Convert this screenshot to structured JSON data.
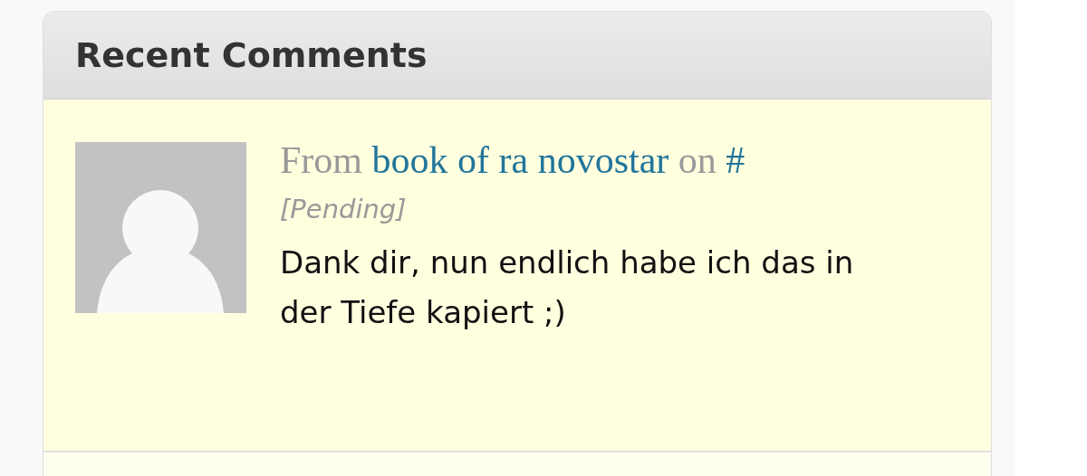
{
  "widget": {
    "title": "Recent Comments"
  },
  "comments": [
    {
      "from_label": "From",
      "author": "book of ra novostar",
      "on_label": "on",
      "post": "#",
      "status": "[Pending]",
      "pending": true,
      "text": "Dank dir, nun endlich habe ich das in der Tiefe kapiert ;)"
    }
  ]
}
